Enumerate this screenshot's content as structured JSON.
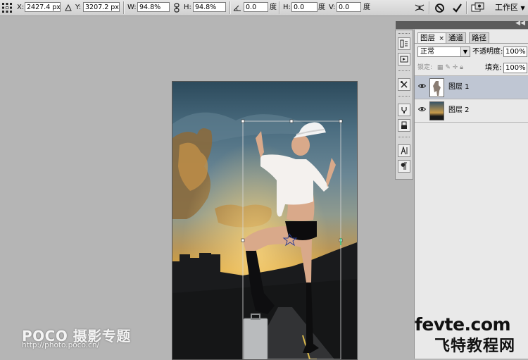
{
  "options_bar": {
    "x_label": "X:",
    "x_value": "2427.4 px",
    "y_label": "Y:",
    "y_value": "3207.2 px",
    "w_label": "W:",
    "w_value": "94.8%",
    "h_label": "H:",
    "h_value": "94.8%",
    "angle_value": "0.0",
    "angle_unit": "度",
    "hskew_label": "H:",
    "hskew_value": "0.0",
    "hskew_unit": "度",
    "vskew_label": "V:",
    "vskew_value": "0.0",
    "workspace_label": "工作区",
    "workspace_arrow": "▼"
  },
  "layers_panel": {
    "tabs": [
      {
        "label": "图层",
        "close": "×"
      },
      {
        "label": "通道"
      },
      {
        "label": "路径"
      }
    ],
    "blend_mode": "正常",
    "opacity_label": "不透明度:",
    "opacity_value": "100%",
    "lock_label": "锁定:",
    "fill_label": "填充:",
    "fill_value": "100%",
    "layers": [
      {
        "name": "图层 1",
        "selected": true
      },
      {
        "name": "图层 2",
        "selected": false
      }
    ]
  },
  "watermarks": {
    "poco_logo": "POCO 摄影专题",
    "poco_url": "http://photo.poco.cn/",
    "fevte_logo": "fevte.com",
    "fevte_cn": "飞特教程网"
  },
  "icons": [
    "reference-point-icon",
    "delta-icon",
    "link-icon",
    "angle-icon",
    "warp-icon",
    "cancel-icon",
    "commit-icon",
    "history-icon",
    "actions-icon",
    "tool-presets-icon",
    "brushes-icon",
    "clone-source-icon",
    "character-icon",
    "paragraph-icon",
    "eye-icon"
  ],
  "colors": {
    "panel_bg": "#e9e9e9",
    "selected_layer": "#bfc6d3",
    "workspace_bg": "#b5b5b5"
  }
}
